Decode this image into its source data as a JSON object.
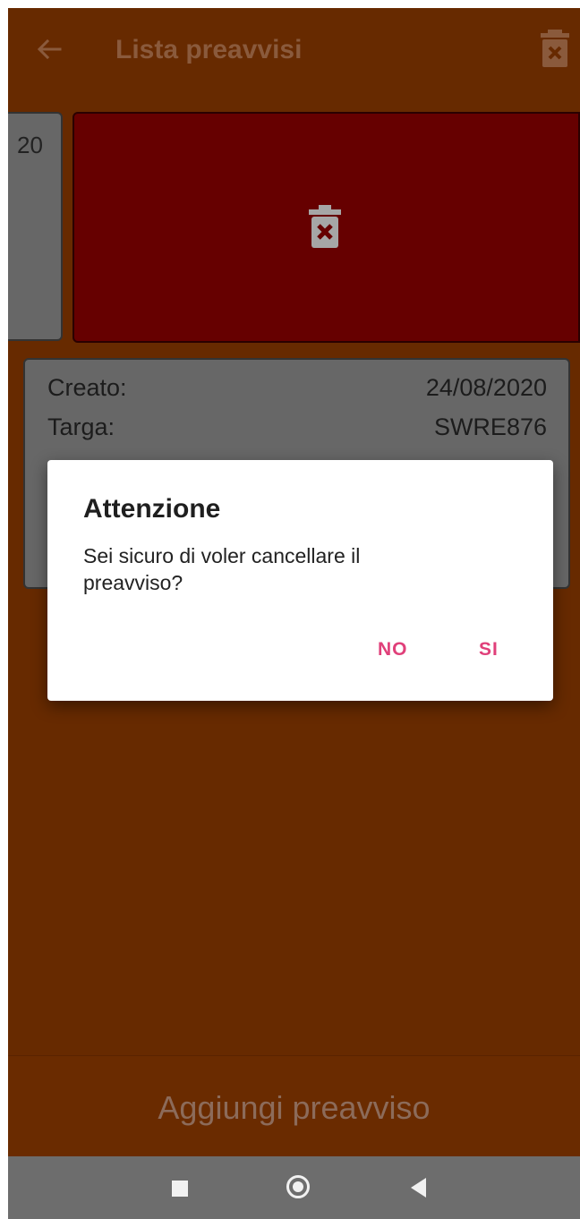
{
  "appbar": {
    "title": "Lista preavvisi"
  },
  "cards": [
    {
      "partial_text": "20"
    },
    {
      "rows": [
        {
          "label": "Creato:",
          "value": "24/08/2020"
        },
        {
          "label": "Targa:",
          "value": "SWRE876"
        }
      ]
    }
  ],
  "dialog": {
    "title": "Attenzione",
    "message": "Sei sicuro di voler cancellare il preavviso?",
    "no_label": "NO",
    "yes_label": "SI"
  },
  "footer": {
    "add_label": "Aggiungi preavviso"
  },
  "colors": {
    "background": "#672a00",
    "delete_area": "#660000",
    "card": "#676767",
    "accent": "#e0407a"
  },
  "icons": [
    "back-arrow-icon",
    "trash-icon",
    "nav-recents-icon",
    "nav-home-icon",
    "nav-back-icon"
  ]
}
